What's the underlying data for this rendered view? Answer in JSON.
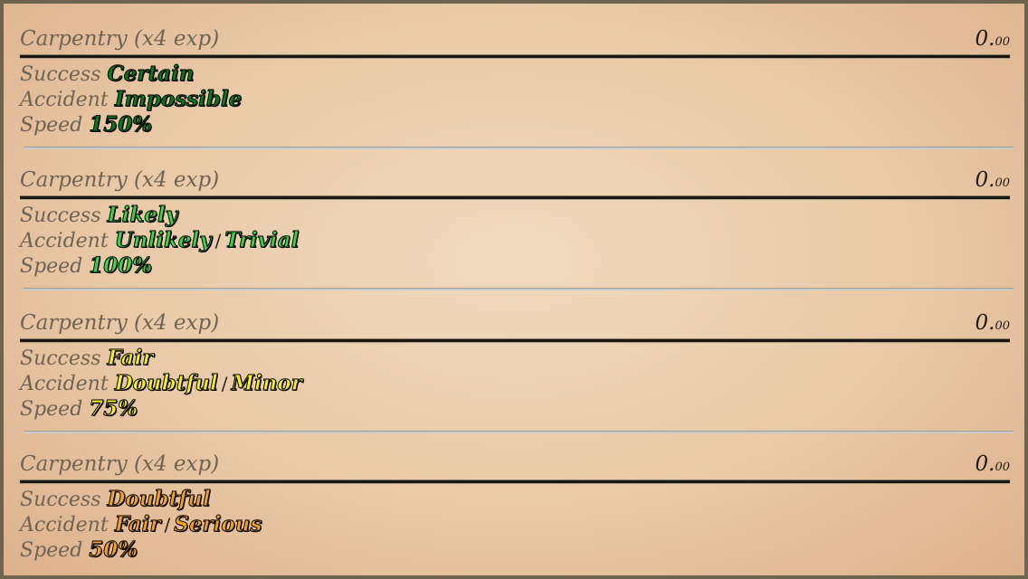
{
  "blocks": [
    {
      "skill": "Carpentry (x4 exp)",
      "exp_int": "0.",
      "exp_dec": "00",
      "success_label": "Success",
      "success_value": "Certain",
      "accident_label": "Accident",
      "accident_value": "Impossible",
      "accident_severity": "",
      "speed_label": "Speed",
      "speed_value": "150%",
      "color": "#0a7a12"
    },
    {
      "skill": "Carpentry (x4 exp)",
      "exp_int": "0.",
      "exp_dec": "00",
      "success_label": "Success",
      "success_value": "Likely",
      "accident_label": "Accident",
      "accident_value": "Unlikely",
      "accident_severity": "Trivial",
      "speed_label": "Speed",
      "speed_value": "100%",
      "color": "#3dd43a"
    },
    {
      "skill": "Carpentry (x4 exp)",
      "exp_int": "0.",
      "exp_dec": "00",
      "success_label": "Success",
      "success_value": "Fair",
      "accident_label": "Accident",
      "accident_value": "Doubtful",
      "accident_severity": "Minor",
      "speed_label": "Speed",
      "speed_value": "75%",
      "color": "#f2f01c"
    },
    {
      "skill": "Carpentry (x4 exp)",
      "exp_int": "0.",
      "exp_dec": "00",
      "success_label": "Success",
      "success_value": "Doubtful",
      "accident_label": "Accident",
      "accident_value": "Fair",
      "accident_severity": "Serious",
      "speed_label": "Speed",
      "speed_value": "50%",
      "color": "#f5a21a"
    }
  ],
  "severity_separator": "/"
}
